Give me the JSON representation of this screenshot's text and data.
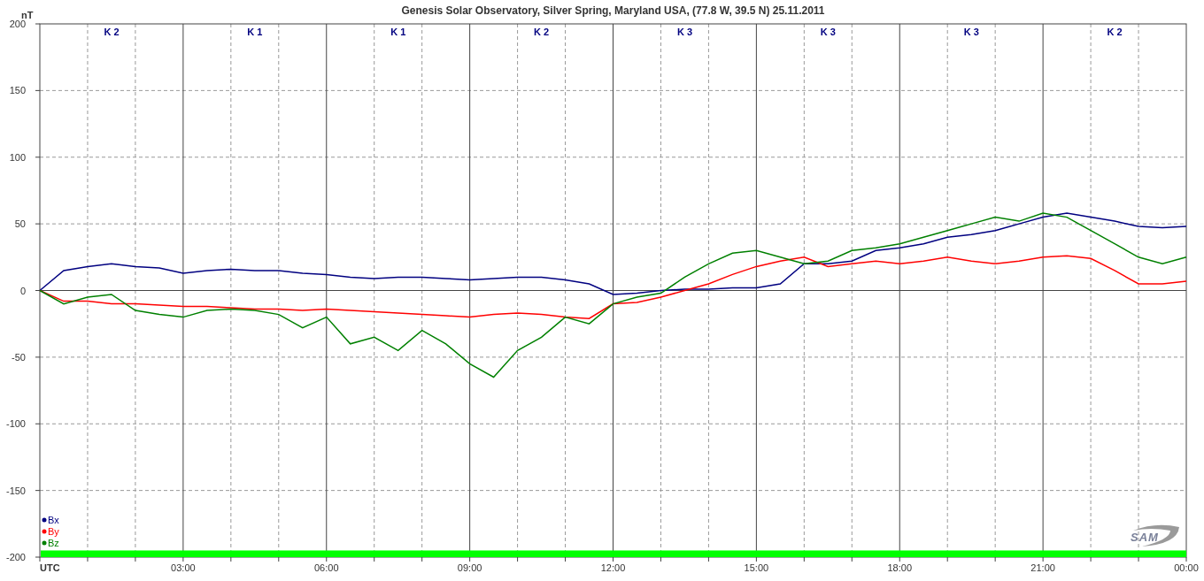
{
  "chart": {
    "chart_data": {
      "type": "line",
      "title": "Genesis Solar Observatory, Silver Spring, Maryland USA, (77.8 W, 39.5 N)  25.11.2011",
      "ylabel": "nT",
      "x": [
        0,
        0.5,
        1,
        1.5,
        2,
        2.5,
        3,
        3.5,
        4,
        4.5,
        5,
        5.5,
        6,
        6.5,
        7,
        7.5,
        8,
        8.5,
        9,
        9.5,
        10,
        10.5,
        11,
        11.5,
        12,
        12.5,
        13,
        13.5,
        14,
        14.5,
        15,
        15.5,
        16,
        16.5,
        17,
        17.5,
        18,
        18.5,
        19,
        19.5,
        20,
        20.5,
        21,
        21.5,
        22,
        22.5,
        23,
        23.5,
        24
      ],
      "grid": true,
      "bands": [
        {
          "axis": "y",
          "from": -200,
          "to": -195,
          "color": "#00ff00"
        }
      ],
      "xlim": [
        0,
        24
      ],
      "ylim": [
        -200,
        200
      ],
      "xticks": [
        {
          "value": 0,
          "label": "UTC"
        },
        {
          "value": 3,
          "label": "03:00"
        },
        {
          "value": 6,
          "label": "06:00"
        },
        {
          "value": 9,
          "label": "09:00"
        },
        {
          "value": 12,
          "label": "12:00"
        },
        {
          "value": 15,
          "label": "15:00"
        },
        {
          "value": 18,
          "label": "18:00"
        },
        {
          "value": 21,
          "label": "21:00"
        },
        {
          "value": 24,
          "label": "00:00"
        }
      ],
      "yticks": [
        200,
        150,
        100,
        50,
        0,
        -50,
        -100,
        -150,
        -200
      ],
      "series": [
        {
          "name": "Bx",
          "color": "#000080",
          "values": [
            0,
            15,
            18,
            20,
            18,
            17,
            13,
            15,
            16,
            15,
            15,
            13,
            12,
            10,
            9,
            10,
            10,
            9,
            8,
            9,
            10,
            10,
            8,
            5,
            -3,
            -2,
            0,
            1,
            1,
            2,
            2,
            5,
            20,
            20,
            22,
            30,
            32,
            35,
            40,
            42,
            45,
            50,
            55,
            58,
            55,
            52,
            48,
            47,
            48
          ]
        },
        {
          "name": "By",
          "color": "#ff0000",
          "values": [
            0,
            -8,
            -8,
            -10,
            -10,
            -11,
            -12,
            -12,
            -13,
            -14,
            -14,
            -15,
            -14,
            -15,
            -16,
            -17,
            -18,
            -19,
            -20,
            -18,
            -17,
            -18,
            -20,
            -21,
            -10,
            -9,
            -5,
            0,
            5,
            12,
            18,
            22,
            25,
            18,
            20,
            22,
            20,
            22,
            25,
            22,
            20,
            22,
            25,
            26,
            24,
            15,
            5,
            5,
            7
          ]
        },
        {
          "name": "Bz",
          "color": "#008000",
          "values": [
            0,
            -10,
            -5,
            -3,
            -15,
            -18,
            -20,
            -15,
            -14,
            -15,
            -18,
            -28,
            -20,
            -40,
            -35,
            -45,
            -30,
            -40,
            -55,
            -65,
            -45,
            -35,
            -20,
            -25,
            -10,
            -5,
            -2,
            10,
            20,
            28,
            30,
            25,
            20,
            22,
            30,
            32,
            35,
            40,
            45,
            50,
            55,
            52,
            58,
            55,
            45,
            35,
            25,
            20,
            25
          ]
        }
      ]
    },
    "k_indices": [
      {
        "label": "K 2"
      },
      {
        "label": "K 1"
      },
      {
        "label": "K 1"
      },
      {
        "label": "K 2"
      },
      {
        "label": "K 3"
      },
      {
        "label": "K 3"
      },
      {
        "label": "K 3"
      },
      {
        "label": "K 2"
      }
    ],
    "logo": "SAM"
  }
}
